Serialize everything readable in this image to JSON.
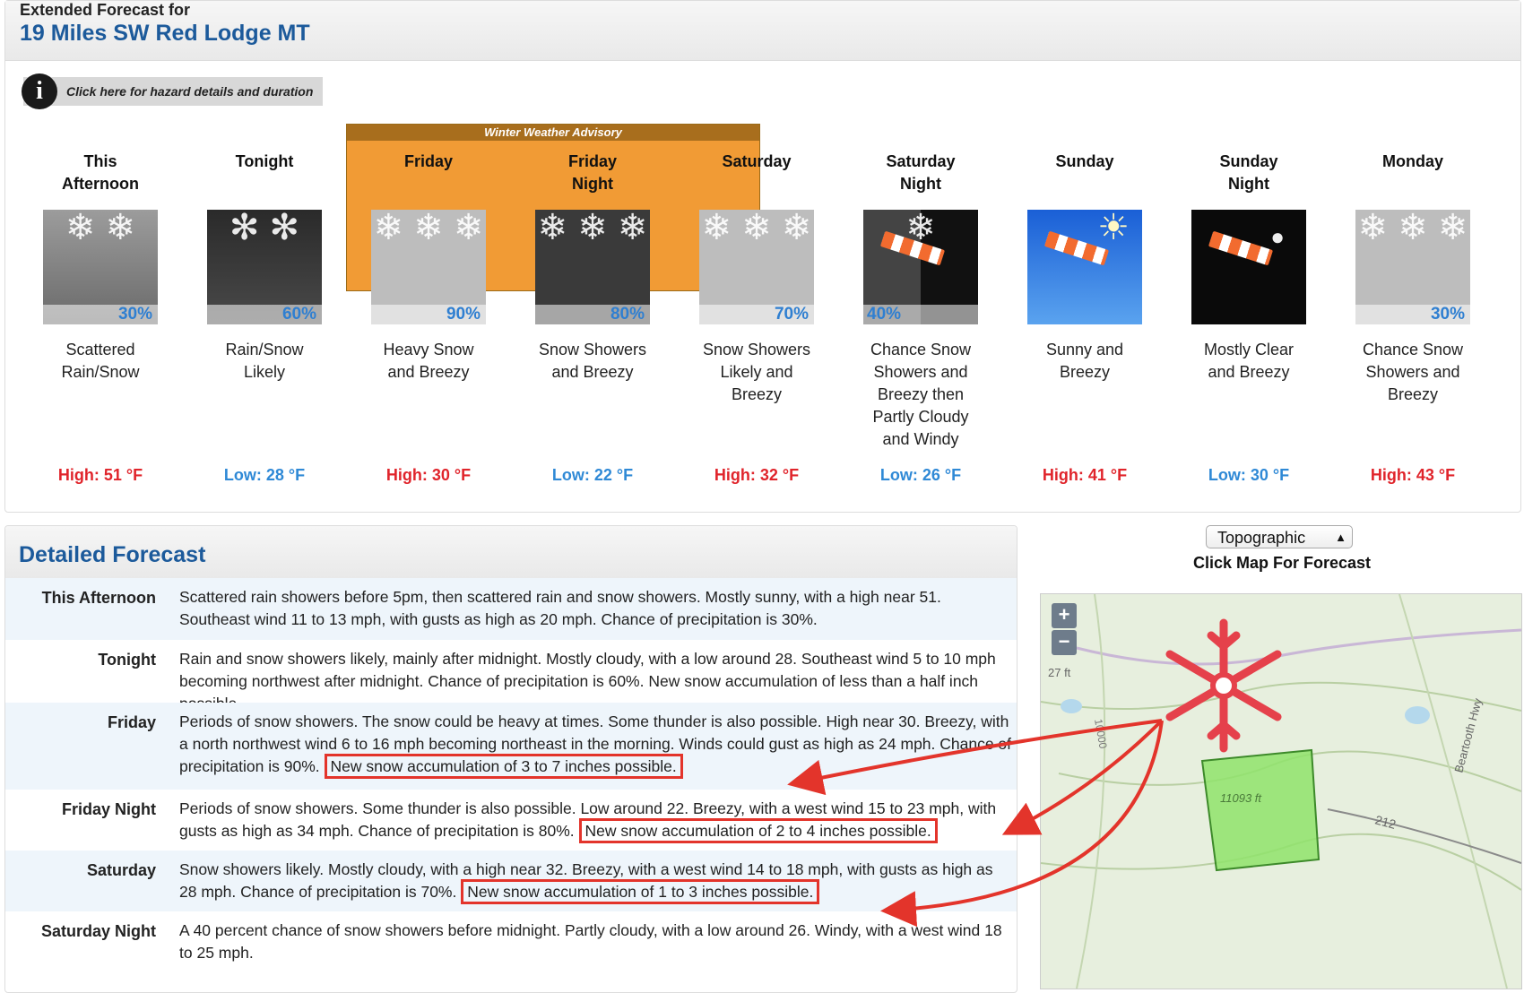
{
  "header": {
    "small_title": "Extended Forecast for",
    "location": "19 Miles SW Red Lodge MT"
  },
  "hazard": {
    "icon": "info-icon",
    "label": "Click here for hazard details and duration"
  },
  "advisory": {
    "label": "Winter Weather Advisory",
    "color": "#f19b35"
  },
  "periods": [
    {
      "name_line1": "This",
      "name_line2": "Afternoon",
      "icon": "rain-snow-icon",
      "pct": "30%",
      "desc": [
        "Scattered",
        "Rain/Snow"
      ],
      "temp": "High: 51 °F",
      "kind": "hi"
    },
    {
      "name_line1": "Tonight",
      "name_line2": "",
      "icon": "rain-snow-night-icon",
      "pct": "60%",
      "desc": [
        "Rain/Snow",
        "Likely"
      ],
      "temp": "Low: 28 °F",
      "kind": "lo"
    },
    {
      "name_line1": "Friday",
      "name_line2": "",
      "icon": "heavy-snow-icon",
      "pct": "90%",
      "desc": [
        "Heavy Snow",
        "and Breezy"
      ],
      "temp": "High: 30 °F",
      "kind": "hi"
    },
    {
      "name_line1": "Friday",
      "name_line2": "Night",
      "icon": "snow-night-icon",
      "pct": "80%",
      "desc": [
        "Snow Showers",
        "and Breezy"
      ],
      "temp": "Low: 22 °F",
      "kind": "lo"
    },
    {
      "name_line1": "Saturday",
      "name_line2": "",
      "icon": "snow-icon",
      "pct": "70%",
      "desc": [
        "Snow Showers",
        "Likely and",
        "Breezy"
      ],
      "temp": "High: 32 °F",
      "kind": "hi"
    },
    {
      "name_line1": "Saturday",
      "name_line2": "Night",
      "icon": "snow-windsock-night-icon",
      "pct": "40%",
      "desc": [
        "Chance Snow",
        "Showers and",
        "Breezy then",
        "Partly Cloudy",
        "and Windy"
      ],
      "temp": "Low: 26 °F",
      "kind": "lo"
    },
    {
      "name_line1": "Sunday",
      "name_line2": "",
      "icon": "sunny-windsock-icon",
      "pct": "",
      "desc": [
        "Sunny and",
        "Breezy"
      ],
      "temp": "High: 41 °F",
      "kind": "hi"
    },
    {
      "name_line1": "Sunday",
      "name_line2": "Night",
      "icon": "clear-night-windsock-icon",
      "pct": "",
      "desc": [
        "Mostly Clear",
        "and Breezy"
      ],
      "temp": "Low: 30 °F",
      "kind": "lo"
    },
    {
      "name_line1": "Monday",
      "name_line2": "",
      "icon": "snow-icon",
      "pct": "30%",
      "desc": [
        "Chance Snow",
        "Showers and",
        "Breezy"
      ],
      "temp": "High: 43 °F",
      "kind": "hi"
    }
  ],
  "detailed": {
    "title": "Detailed Forecast",
    "rows": [
      {
        "label": "This Afternoon",
        "text": "Scattered rain showers before 5pm, then scattered rain and snow showers. Mostly sunny, with a high near 51. Southeast wind 11 to 13 mph, with gusts as high as 20 mph. Chance of precipitation is 30%.",
        "highlight": ""
      },
      {
        "label": "Tonight",
        "text": "Rain and snow showers likely, mainly after midnight. Mostly cloudy, with a low around 28. Southeast wind 5 to 10 mph becoming northwest after midnight. Chance of precipitation is 60%. New snow accumulation of less than a half inch possible.",
        "highlight": ""
      },
      {
        "label": "Friday",
        "text": "Periods of snow showers. The snow could be heavy at times. Some thunder is also possible. High near 30. Breezy, with a north northwest wind 6 to 16 mph becoming northeast in the morning. Winds could gust as high as 24 mph. Chance of precipitation is 90%.",
        "highlight": "New snow accumulation of 3 to 7 inches possible."
      },
      {
        "label": "Friday Night",
        "text": "Periods of snow showers. Some thunder is also possible. Low around 22. Breezy, with a west wind 15 to 23 mph, with gusts as high as 34 mph. Chance of precipitation is 80%.",
        "highlight": "New snow accumulation of 2 to 4 inches possible."
      },
      {
        "label": "Saturday",
        "text": "Snow showers likely. Mostly cloudy, with a high near 32. Breezy, with a west wind 14 to 18 mph, with gusts as high as 28 mph. Chance of precipitation is 70%.",
        "highlight": "New snow accumulation of 1 to 3 inches possible."
      },
      {
        "label": "Saturday Night",
        "text": "A 40 percent chance of snow showers before midnight. Partly cloudy, with a low around 26. Windy, with a west wind 18 to 25 mph.",
        "highlight": ""
      }
    ]
  },
  "map": {
    "select_value": "Topographic",
    "caption": "Click Map For Forecast",
    "zoom_in": "+",
    "zoom_out": "−",
    "elev_label_1": "27 ft",
    "elev_label_2": "10000",
    "elev_label_3": "11093 ft",
    "road_label": "Beartooth Hwy",
    "route_label": "212",
    "marker_icon": "snowflake-marker-icon",
    "forecast_area_color": "#8fe36b"
  },
  "colors": {
    "high": "#e0242b",
    "low": "#2f89d6",
    "title": "#1c5a9b",
    "annotation": "#e3342b"
  }
}
